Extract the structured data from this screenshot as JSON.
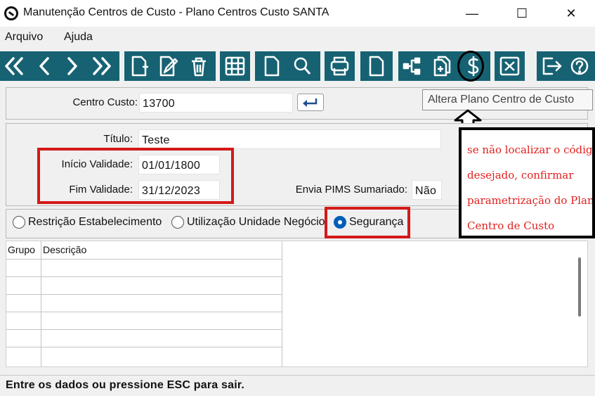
{
  "window": {
    "title": "Manutenção Centros de Custo - Plano Centros Custo SANTA",
    "minimize_glyph": "—",
    "maximize_glyph": "☐",
    "close_glyph": "✕"
  },
  "menu": {
    "items": [
      "Arquivo",
      "Ajuda"
    ]
  },
  "toolbar": {
    "buttons": [
      "first-record-icon",
      "previous-record-icon",
      "next-record-icon",
      "last-record-icon",
      "new-record-icon",
      "edit-record-icon",
      "delete-record-icon",
      "grid-view-icon",
      "document-icon",
      "search-icon",
      "print-icon",
      "page-icon",
      "hierarchy-icon",
      "copy-icon",
      "dollar-icon",
      "cancel-icon",
      "exit-icon",
      "help-icon"
    ]
  },
  "tooltip": {
    "text": "Altera Plano Centro de Custo"
  },
  "header_panel": {
    "centro_custo_label": "Centro Custo:",
    "centro_custo_value": "13700"
  },
  "details": {
    "titulo_label": "Título:",
    "titulo_value": "Teste",
    "inicio_label": "Início Validade:",
    "inicio_value": "01/01/1800",
    "fim_label": "Fim Validade:",
    "fim_value": "31/12/2023",
    "pims_label": "Envia PIMS Sumariado:",
    "pims_value": "Não"
  },
  "annotation": {
    "lines": [
      "se não localizar o código",
      "desejado, confirmar",
      "parametrização do Plano de",
      "Centro de Custo"
    ],
    "color": "#e0211f"
  },
  "tabs": {
    "options": [
      "Restrição Estabelecimento",
      "Utilização Unidade Negócio",
      "Segurança"
    ],
    "selected": "Segurança"
  },
  "table": {
    "columns": [
      "Grupo",
      "Descrição"
    ]
  },
  "status": {
    "text": "Entre os dados ou pressione ESC para sair."
  },
  "colors": {
    "toolbar": "#166273",
    "highlight": "#d41919",
    "radio_selected": "#005fb8"
  }
}
